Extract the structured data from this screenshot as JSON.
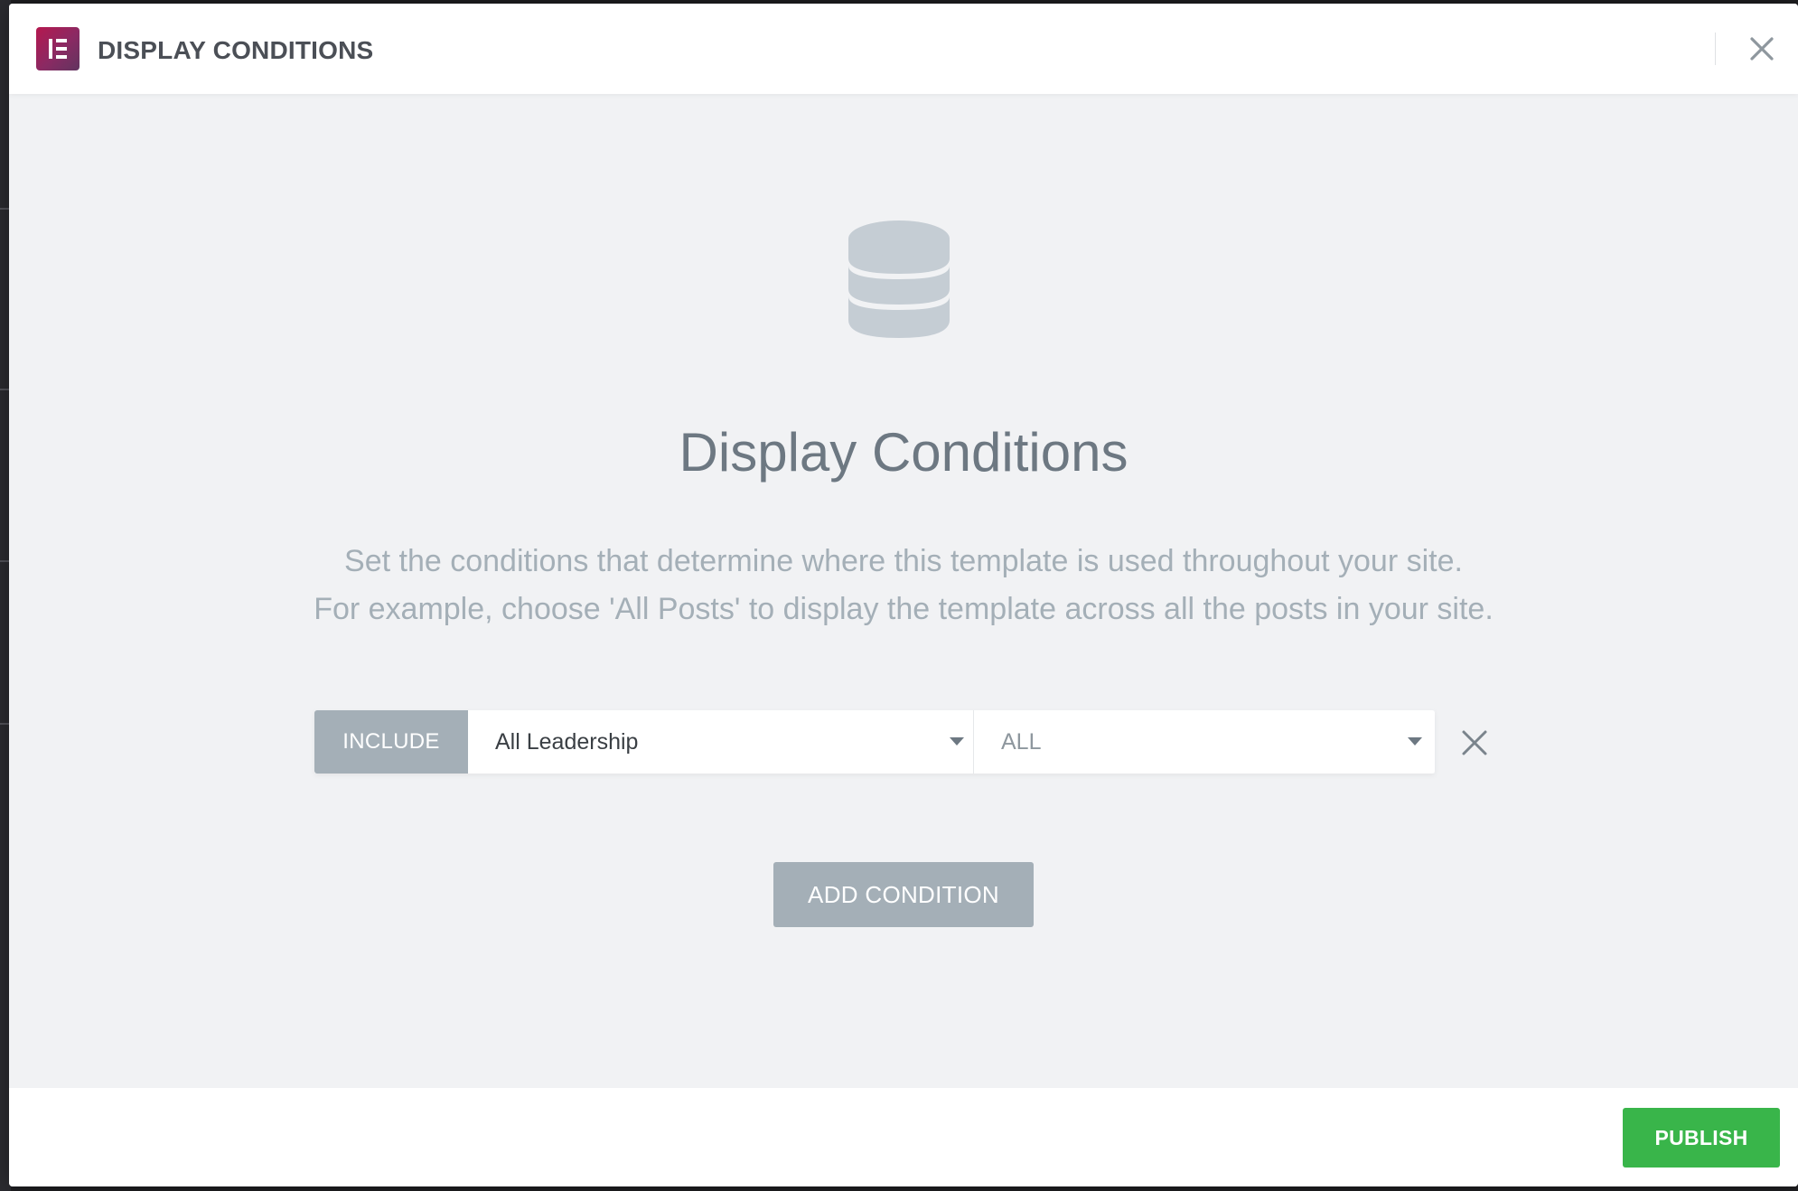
{
  "header": {
    "title": "DISPLAY CONDITIONS",
    "logo_icon": "elementor-logo-icon",
    "close_icon": "close-icon"
  },
  "main": {
    "icon": "database-icon",
    "title": "Display Conditions",
    "description_line1": "Set the conditions that determine where this template is used throughout your site.",
    "description_line2": "For example, choose 'All Posts' to display the template across all the posts in your site."
  },
  "condition": {
    "type_label": "INCLUDE",
    "primary_select_value": "All Leadership",
    "secondary_select_value": "ALL",
    "remove_icon": "remove-condition-icon"
  },
  "actions": {
    "add_condition_label": "ADD CONDITION",
    "publish_label": "PUBLISH"
  },
  "colors": {
    "accent_green": "#39b54a",
    "muted_button": "#a4afb7",
    "brand_magenta": "#b5184f",
    "body_bg": "#f1f2f4"
  }
}
